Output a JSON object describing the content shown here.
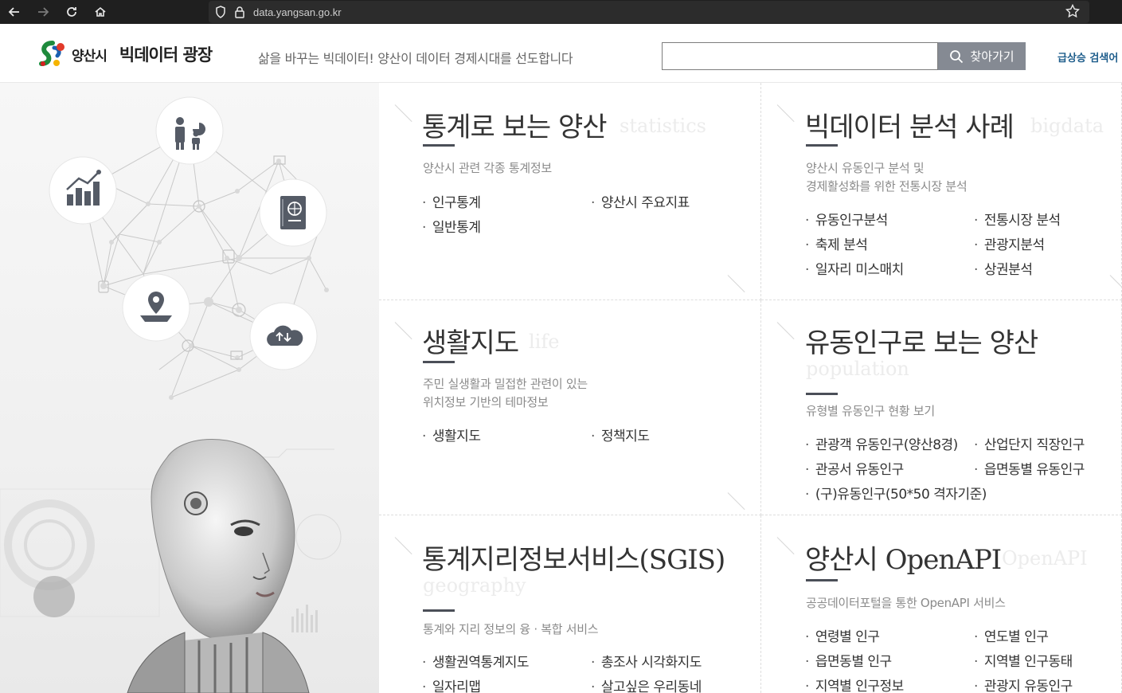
{
  "browser": {
    "url": "data.yangsan.go.kr"
  },
  "header": {
    "logo_city": "양산시",
    "logo_title": "빅데이터 광장",
    "slogan": "삶을 바꾸는 빅데이터! 양산이 데이터 경제시대를 선도합니다",
    "search_placeholder": "",
    "search_button": "찾아가기",
    "trending_label": "급상승 검색어"
  },
  "colors": {
    "accent": "#4b4f58",
    "search_button": "#858a93",
    "trending": "#1f5e8c"
  },
  "cards": [
    {
      "title": "통계로 보는 양산",
      "en": "statistics",
      "desc": [
        "양산시 관련 각종 통계정보"
      ],
      "links": [
        "인구통계",
        "양산시 주요지표",
        "일반통계"
      ]
    },
    {
      "title": "빅데이터 분석 사례",
      "en": "bigdata",
      "desc": [
        "양산시 유동인구 분석 및",
        "경제활성화를 위한 전통시장 분석"
      ],
      "links": [
        "유동인구분석",
        "전통시장 분석",
        "축제 분석",
        "관광지분석",
        "일자리 미스매치",
        "상권분석"
      ]
    },
    {
      "title": "생활지도",
      "en": "life",
      "desc": [
        "주민 실생활과 밀접한 관련이 있는",
        "위치정보 기반의 테마정보"
      ],
      "links": [
        "생활지도",
        "정책지도"
      ]
    },
    {
      "title": "유동인구로 보는 양산",
      "en": "population",
      "desc": [
        "유형별 유동인구 현황 보기"
      ],
      "links": [
        "관광객 유동인구(양산8경)",
        "산업단지 직장인구",
        "관공서 유동인구",
        "읍면동별 유동인구",
        "(구)유동인구(50*50 격자기준)"
      ]
    },
    {
      "title": "통계지리정보서비스(SGIS)",
      "en": "geography",
      "desc": [
        "통계와 지리 정보의 융 · 복합 서비스"
      ],
      "links": [
        "생활권역통계지도",
        "총조사 시각화지도",
        "일자리맵",
        "살고싶은 우리동네"
      ]
    },
    {
      "title": "양산시 OpenAPI",
      "en": "OpenAPI",
      "desc": [
        "공공데이터포털을 통한 OpenAPI 서비스"
      ],
      "links": [
        "연령별 인구",
        "연도별 인구",
        "읍면동별 인구",
        "지역별 인구동태",
        "지역별 인구정보",
        "관광지 유동인구"
      ]
    }
  ]
}
